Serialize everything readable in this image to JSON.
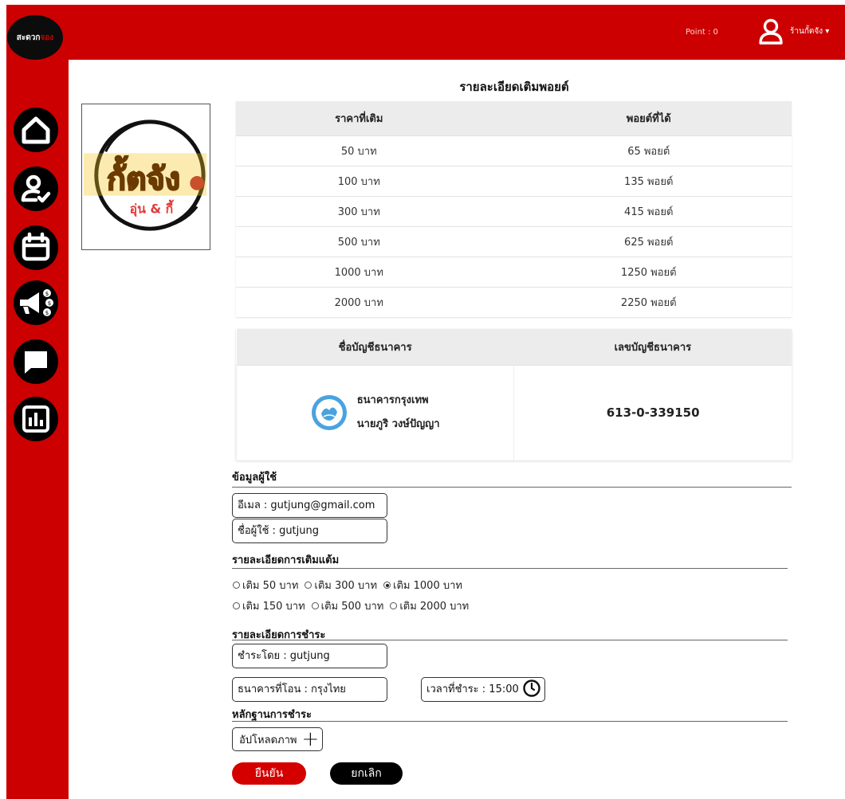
{
  "header": {
    "logo_text": "สะดวก",
    "logo_text_accent": "จอง",
    "point_label": "Point : 0",
    "store_name": "ร้านกั้ตจัง"
  },
  "sidebar": {
    "items": [
      {
        "icon": "home-icon"
      },
      {
        "icon": "user-check-icon"
      },
      {
        "icon": "calendar-icon"
      },
      {
        "icon": "megaphone-icon"
      },
      {
        "icon": "chat-icon"
      },
      {
        "icon": "bar-chart-icon"
      }
    ]
  },
  "store_logo": {
    "text_main": "กั้ตจัง",
    "text_sub": "อุ่น & กี้"
  },
  "page": {
    "title": "รายละเอียดเติมพอยต์"
  },
  "price_table": {
    "headers": [
      "ราคาที่เติม",
      "พอยต์ที่ได้"
    ],
    "rows": [
      [
        "50 บาท",
        "65 พอยต์"
      ],
      [
        "100 บาท",
        "135 พอยต์"
      ],
      [
        "300 บาท",
        "415 พอยต์"
      ],
      [
        "500 บาท",
        "625 พอยต์"
      ],
      [
        "1000 บาท",
        "1250 พอยต์"
      ],
      [
        "2000 บาท",
        "2250 พอยต์"
      ]
    ]
  },
  "bank_table": {
    "headers": [
      "ชื่อบัญชีธนาคาร",
      "เลขบัญชีธนาคาร"
    ],
    "bank_name": "ธนาคารกรุงเทพ",
    "account_name": "นายภูริ วงษ์ปัญญา",
    "account_number": "613-0-339150"
  },
  "user_info": {
    "section_title": "ข้อมูลผู้ใช้",
    "email": "อีเมล : gutjung@gmail.com",
    "username": "ชื่อผู้ใช้ : gutjung"
  },
  "topup": {
    "section_title": "รายละเอียดการเติมแต้ม",
    "options": [
      {
        "label": "เติม 50 บาท",
        "selected": false
      },
      {
        "label": "เติม 300 บาท",
        "selected": false
      },
      {
        "label": "เติม 1000 บาท",
        "selected": true
      },
      {
        "label": "เติม 150 บาท",
        "selected": false
      },
      {
        "label": "เติม 500 บาท",
        "selected": false
      },
      {
        "label": "เติม 2000 บาท",
        "selected": false
      }
    ]
  },
  "payment": {
    "section_title": "รายละเอียดการชำระ",
    "paid_by": "ชำระโดย :  gutjung",
    "bank_transfer": "ธนาคารที่โอน : กรุงไทย",
    "time": "เวลาที่ชำระ : 15:00"
  },
  "evidence": {
    "section_title": "หลักฐานการชำระ",
    "upload_label": "อัปโหลดภาพ"
  },
  "actions": {
    "confirm": "ยืนยัน",
    "cancel": "ยกเลิก"
  },
  "colors": {
    "brand_red": "#cc0000",
    "button_red": "#d40000",
    "button_black": "#000000"
  }
}
